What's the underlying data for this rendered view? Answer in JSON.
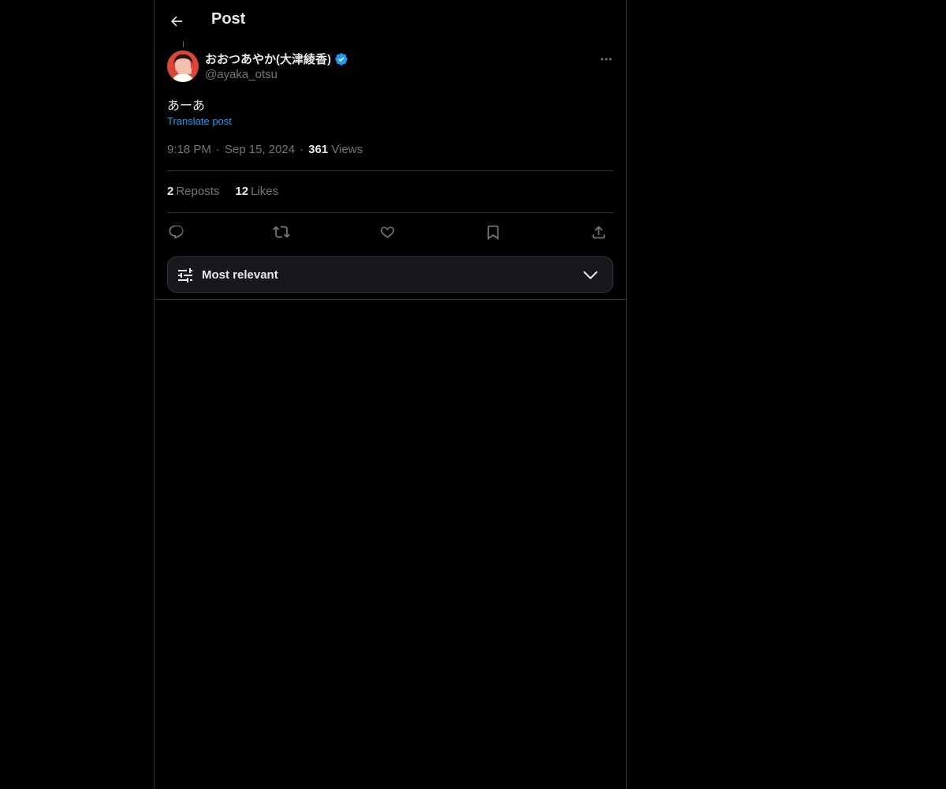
{
  "header": {
    "title": "Post",
    "back_icon": "arrow-left-icon"
  },
  "post": {
    "author": {
      "display_name": "おおつあやか(大津綾香)",
      "handle": "@ayaka_otsu",
      "verified": true,
      "avatar_colors": [
        "#d9463a",
        "#f2c1ad"
      ]
    },
    "text": "あーあ",
    "translate_label": "Translate post",
    "time": "9:18 PM",
    "date": "Sep 15, 2024",
    "views_count": "361",
    "views_label": "Views",
    "reposts_count": "2",
    "reposts_label": "Reposts",
    "likes_count": "12",
    "likes_label": "Likes",
    "meta_separator": "·"
  },
  "actions": [
    "reply-icon",
    "repost-icon",
    "like-icon",
    "bookmark-icon",
    "share-icon"
  ],
  "sort": {
    "label": "Most relevant",
    "icon": "sliders-icon",
    "chevron": "chevron-down-icon"
  },
  "colors": {
    "background": "#000000",
    "text_primary": "#e7e9ea",
    "text_secondary": "#71767b",
    "accent": "#1d9bf0",
    "border": "#2f3336"
  }
}
